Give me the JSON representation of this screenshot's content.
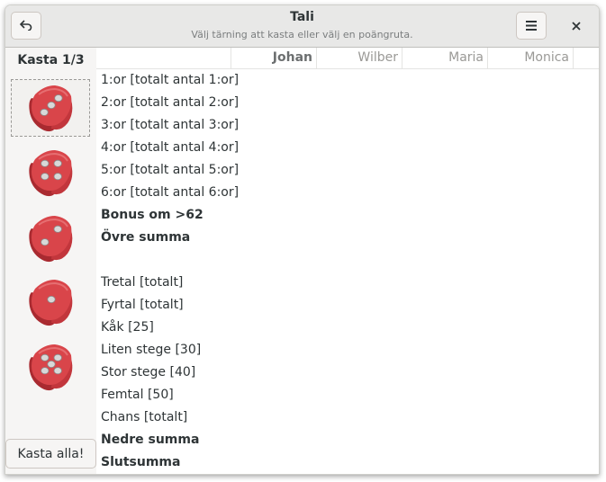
{
  "header": {
    "title": "Tali",
    "subtitle": "Välj tärning att kasta eller välj en poängruta.",
    "back_icon": "undo-arrow-icon",
    "menu_icon": "hamburger-menu-icon",
    "close_icon": "close-icon"
  },
  "sidebar": {
    "roll_label": "Kasta 1/3",
    "roll_all_label": "Kasta alla!",
    "dice": [
      {
        "value": 3,
        "selected": true
      },
      {
        "value": 4,
        "selected": false
      },
      {
        "value": 2,
        "selected": false
      },
      {
        "value": 1,
        "selected": false
      },
      {
        "value": 5,
        "selected": false
      }
    ],
    "die_color": "#d9454a"
  },
  "players": [
    "Johan",
    "Wilber",
    "Maria",
    "Monica"
  ],
  "active_player": "Johan",
  "rows": [
    {
      "label": "1:or [totalt antal 1:or]",
      "bold": false
    },
    {
      "label": "2:or [totalt antal 2:or]",
      "bold": false
    },
    {
      "label": "3:or [totalt antal 3:or]",
      "bold": false
    },
    {
      "label": "4:or [totalt antal 4:or]",
      "bold": false
    },
    {
      "label": "5:or [totalt antal 5:or]",
      "bold": false
    },
    {
      "label": "6:or [totalt antal 6:or]",
      "bold": false
    },
    {
      "label": "Bonus om >62",
      "bold": true
    },
    {
      "label": "Övre summa",
      "bold": true
    },
    {
      "label": "",
      "bold": false
    },
    {
      "label": "Tretal [totalt]",
      "bold": false
    },
    {
      "label": "Fyrtal [totalt]",
      "bold": false
    },
    {
      "label": "Kåk [25]",
      "bold": false
    },
    {
      "label": "Liten stege [30]",
      "bold": false
    },
    {
      "label": "Stor stege [40]",
      "bold": false
    },
    {
      "label": "Femtal [50]",
      "bold": false
    },
    {
      "label": "Chans [totalt]",
      "bold": false
    },
    {
      "label": "Nedre summa",
      "bold": true
    },
    {
      "label": "Slutsumma",
      "bold": true
    }
  ]
}
